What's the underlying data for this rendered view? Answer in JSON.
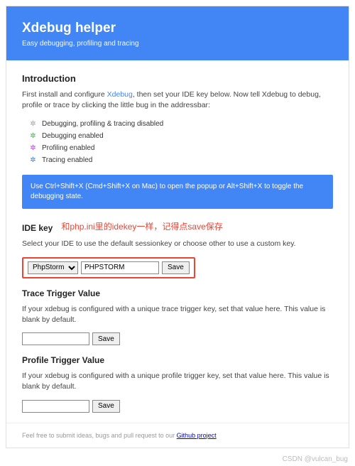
{
  "header": {
    "title": "Xdebug helper",
    "subtitle": "Easy debugging, profiling and tracing"
  },
  "intro": {
    "heading": "Introduction",
    "text_before": "First install and configure ",
    "xdebug_link": "Xdebug",
    "text_after": ", then set your IDE key below. Now tell Xdebug to debug, profile or trace by clicking the little bug in the addressbar:"
  },
  "legend": {
    "items": [
      {
        "color": "#9e9e9e",
        "label": "Debugging, profiling & tracing disabled"
      },
      {
        "color": "#3bb54a",
        "label": "Debugging enabled"
      },
      {
        "color": "#b049d8",
        "label": "Profiling enabled"
      },
      {
        "color": "#3b7cd8",
        "label": "Tracing enabled"
      }
    ]
  },
  "notice": "Use Ctrl+Shift+X (Cmd+Shift+X on Mac) to open the popup or Alt+Shift+X to toggle the debugging state.",
  "ide": {
    "heading": "IDE key",
    "annotation": "和php.ini里的idekey一样，记得点save保存",
    "desc": "Select your IDE to use the default sessionkey or choose other to use a custom key.",
    "select_value": "PhpStorm",
    "input_value": "PHPSTORM",
    "save": "Save"
  },
  "trace": {
    "heading": "Trace Trigger Value",
    "desc": "If your xdebug is configured with a unique trace trigger key, set that value here. This value is blank by default.",
    "input_value": "",
    "save": "Save"
  },
  "profile": {
    "heading": "Profile Trigger Value",
    "desc": "If your xdebug is configured with a unique profile trigger key, set that value here. This value is blank by default.",
    "input_value": "",
    "save": "Save"
  },
  "footer": {
    "text_before": "Feel free to submit ideas, bugs and pull request to our ",
    "link": "Github project"
  },
  "watermark": "CSDN @vulcan_bug"
}
